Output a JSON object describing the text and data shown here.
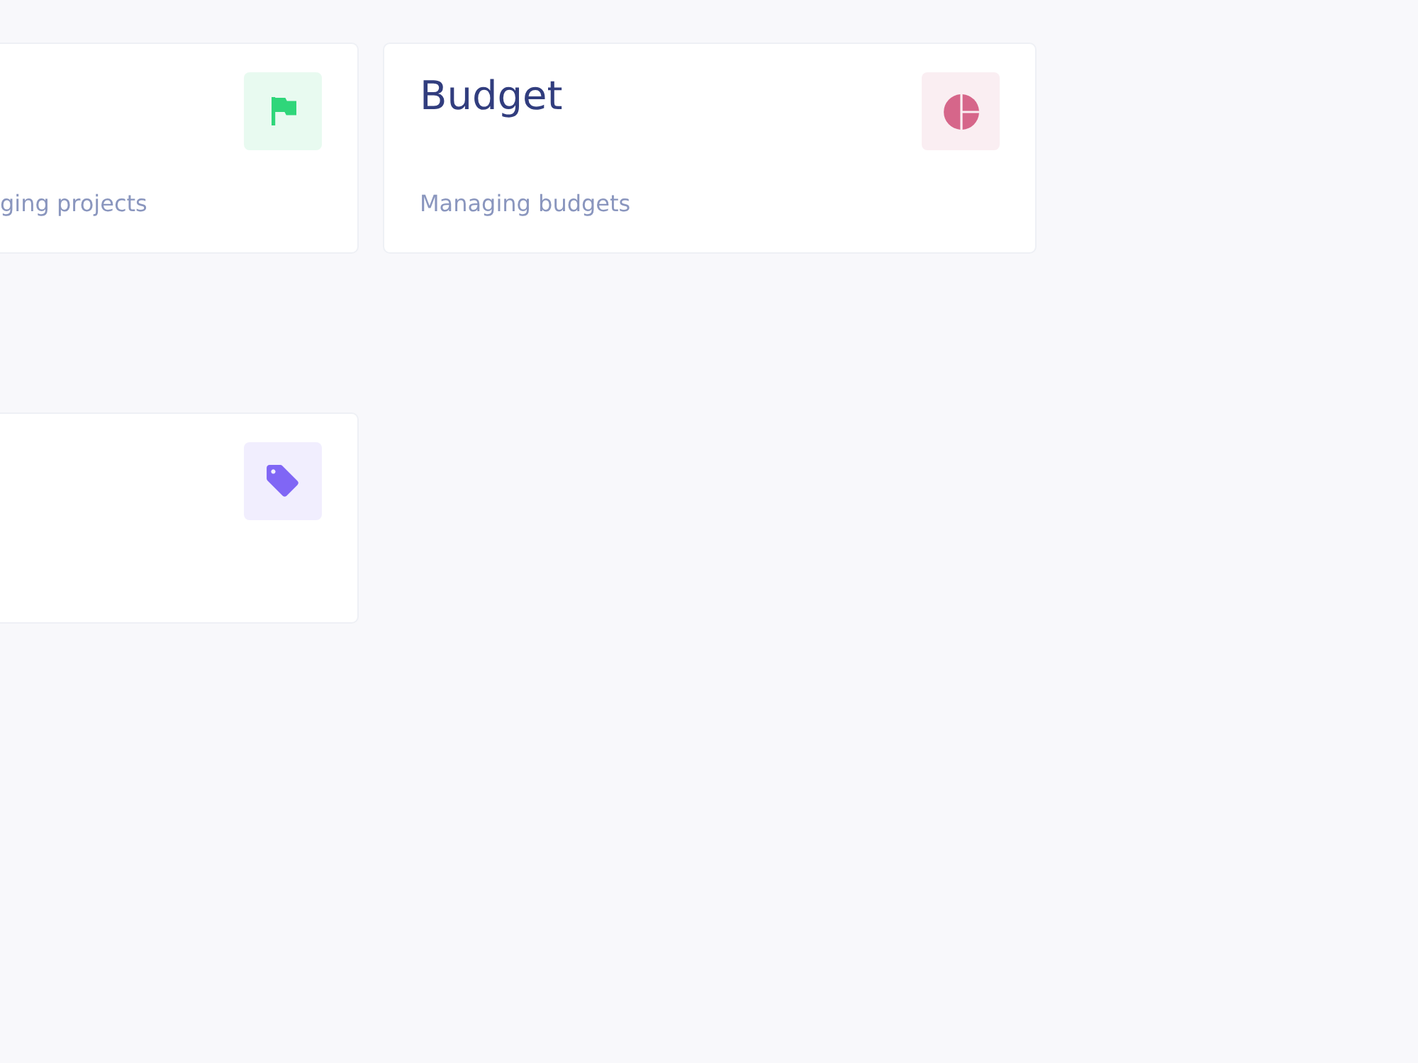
{
  "cards": [
    {
      "description": "ging projects",
      "kind": "flag",
      "color": "#2fd67a"
    },
    {
      "title": "Budget",
      "description": "Managing budgets",
      "kind": "pie",
      "color": "#d6668a"
    },
    {
      "kind": "tag",
      "color": "#8066f5"
    }
  ]
}
